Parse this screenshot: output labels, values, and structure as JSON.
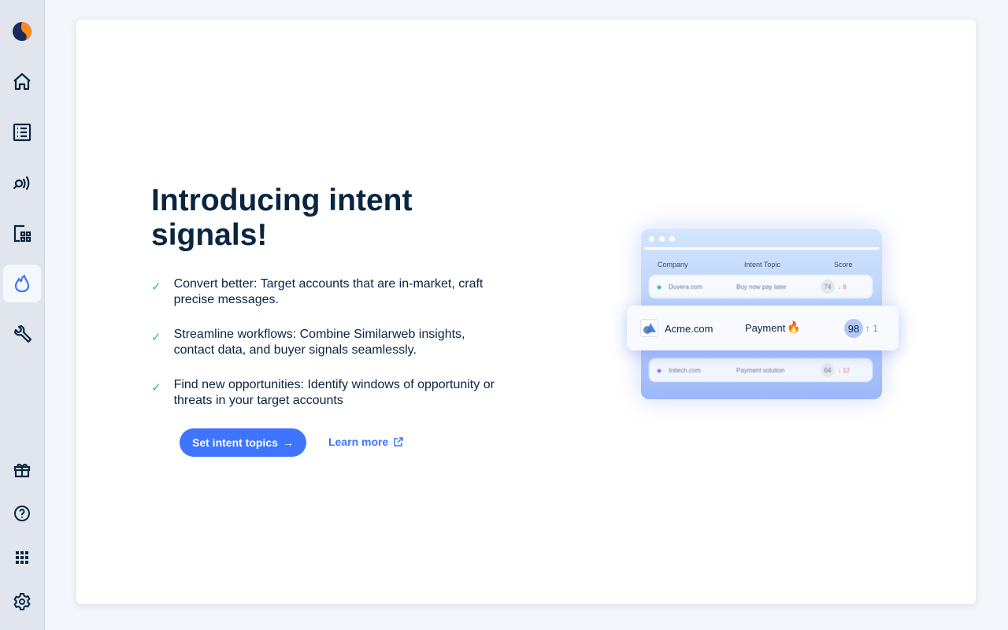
{
  "sidebar": {
    "items": [
      {
        "icon": "similarweb-logo-icon"
      },
      {
        "icon": "home-icon"
      },
      {
        "icon": "list-icon"
      },
      {
        "icon": "search-signal-icon"
      },
      {
        "icon": "grid-table-icon"
      },
      {
        "icon": "fire-icon",
        "active": true
      },
      {
        "icon": "wrench-icon"
      },
      {
        "icon": "gift-icon"
      },
      {
        "icon": "help-icon"
      },
      {
        "icon": "apps-grid-icon"
      },
      {
        "icon": "settings-icon"
      }
    ]
  },
  "main": {
    "title": "Introducing intent signals!",
    "bullets": [
      "Convert better: Target accounts that are in-market, craft precise messages.",
      "Streamline workflows: Combine Similarweb insights, contact data, and buyer signals seamlessly.",
      "Find new opportunities: Identify windows of opportunity or threats in your target accounts"
    ],
    "primary_button": "Set intent topics",
    "learn_more": "Learn more"
  },
  "illustration": {
    "headers": [
      "Company",
      "Intent Topic",
      "Score"
    ],
    "rows": [
      {
        "company": "Duvera.com",
        "topic": "Buy now pay later",
        "score": "74",
        "change": "↓ 8"
      },
      {
        "company": "Acme.com",
        "topic": "Payment",
        "score": "98",
        "change": "↑ 1"
      },
      {
        "company": "Initech.com",
        "topic": "Payment solution",
        "score": "64",
        "change": "↓ 12"
      }
    ]
  },
  "colors": {
    "accent": "#3e74fe",
    "check": "#2bbf87",
    "down": "#f06a6a",
    "up": "#3dbb5e",
    "text": "#092540"
  }
}
